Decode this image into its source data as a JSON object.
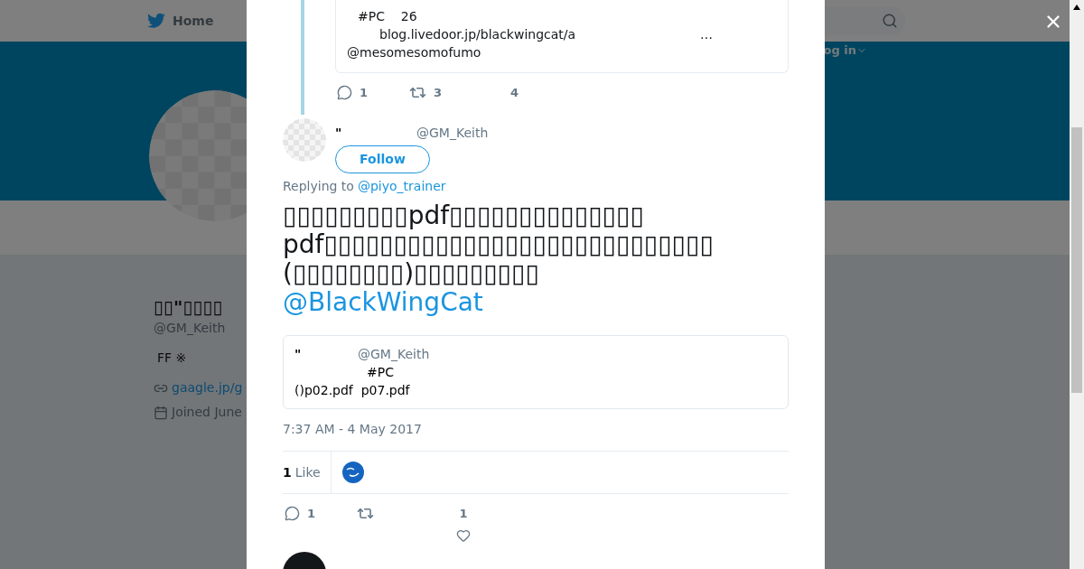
{
  "background_page": {
    "nav": {
      "home": "Home",
      "login": "og in"
    },
    "profile": {
      "name": "▯▯\"▯▯▯▯",
      "handle": "@GM_Keith",
      "bio": "FF ※",
      "link": "gaagle.jp/g",
      "joined": "Joined June"
    }
  },
  "modal": {
    "parent_tweet": {
      "lines": [
        "#PC    26",
        "blog.livedoor.jp/blackwingcat/a",
        "@mesomesomofumo"
      ],
      "ellipsis": "…",
      "replies": "1",
      "retweets": "3",
      "likes": "4"
    },
    "tweet": {
      "name": "\"",
      "handle": "@GM_Keith",
      "follow": "Follow",
      "replying_label": "Replying to",
      "replying_to": "@piyo_trainer",
      "text_lines": [
        "▯▯▯▯▯▯▯▯▯pdf▯▯▯▯▯▯▯▯▯▯▯▯▯▯",
        "pdf▯▯▯▯▯▯▯▯▯▯▯▯▯▯▯▯▯▯▯▯▯▯▯▯▯▯▯▯",
        "(▯▯▯▯▯▯▯▯)▯▯▯▯▯▯▯▯▯"
      ],
      "mention": "@BlackWingCat",
      "quote": {
        "name": "\"",
        "handle": "@GM_Keith",
        "lines": [
          "#PC",
          "()p02.pdf  p07.pdf"
        ]
      },
      "timestamp": "7:37 AM - 4 May 2017",
      "like_count": "1",
      "like_label": "Like",
      "replies": "1",
      "likes": "1"
    }
  }
}
